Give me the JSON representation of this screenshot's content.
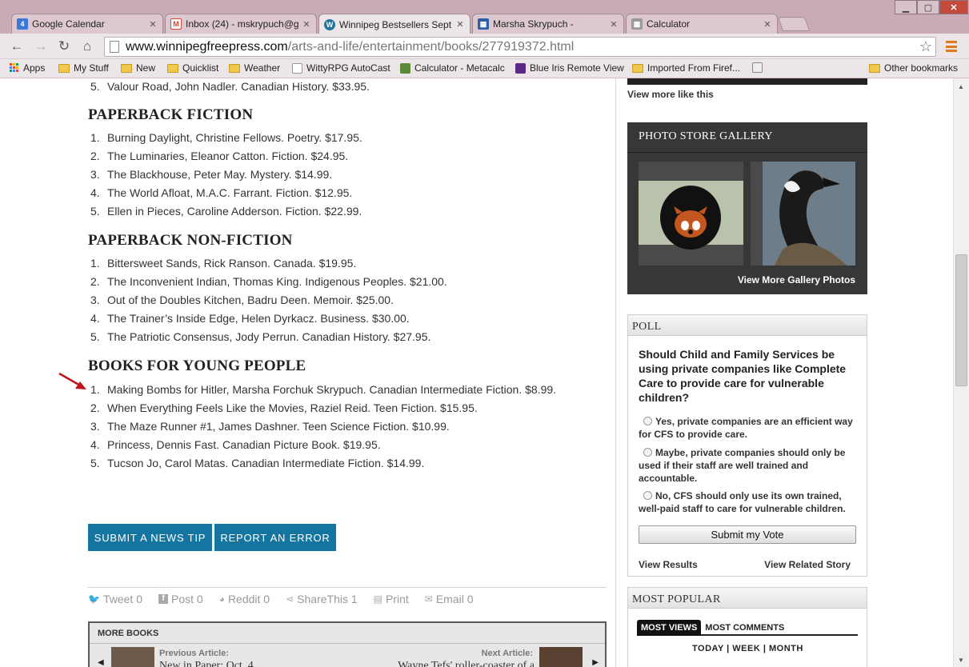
{
  "browser": {
    "tabs": [
      {
        "title": "Google Calendar",
        "icon": "calendar-icon",
        "color": "#3a78d8"
      },
      {
        "title": "Inbox (24) - mskrypuch@g",
        "icon": "gmail-icon",
        "color": "#d44638"
      },
      {
        "title": "Winnipeg Bestsellers Sept",
        "icon": "wordpress-icon",
        "color": "#21759b"
      },
      {
        "title": "Marsha Skrypuch -",
        "icon": "grid-icon",
        "color": "#2d5fa8"
      },
      {
        "title": "Calculator",
        "icon": "calculator-icon",
        "color": "#9a9a9a"
      }
    ],
    "url_host": "www.winnipegfreepress.com",
    "url_path": "/arts-and-life/entertainment/books/277919372.html",
    "bookmarks": [
      "Apps",
      "My Stuff",
      "New",
      "Quicklist",
      "Weather",
      "WittyRPG AutoCast",
      "Calculator - Metacalc",
      "Blue Iris Remote View",
      "Imported From Firef...",
      "Other bookmarks"
    ]
  },
  "article": {
    "top_item": {
      "num": "5.",
      "text": "Valour Road, John Nadler. Canadian History. $33.95."
    },
    "sections": [
      {
        "heading": "PAPERBACK FICTION",
        "items": [
          "Burning Daylight, Christine Fellows. Poetry. $17.95.",
          "The Luminaries, Eleanor Catton. Fiction. $24.95.",
          "The Blackhouse, Peter May. Mystery. $14.99.",
          "The World Afloat, M.A.C. Farrant. Fiction. $12.95.",
          "Ellen in Pieces, Caroline Adderson. Fiction. $22.99."
        ]
      },
      {
        "heading": "PAPERBACK NON-FICTION",
        "items": [
          "Bittersweet Sands, Rick Ranson. Canada. $19.95.",
          "The Inconvenient Indian, Thomas King. Indigenous Peoples. $21.00.",
          "Out of the Doubles Kitchen, Badru Deen. Memoir. $25.00.",
          "The Trainer’s Inside Edge, Helen Dyrkacz. Business. $30.00.",
          "The Patriotic Consensus, Jody Perrun. Canadian History. $27.95."
        ]
      },
      {
        "heading": "BOOKS FOR YOUNG PEOPLE",
        "items": [
          "Making Bombs for Hitler, Marsha Forchuk Skrypuch. Canadian Intermediate Fiction. $8.99.",
          "When Everything Feels Like the Movies, Raziel Reid. Teen Fiction. $15.95.",
          "The Maze Runner #1, James Dashner. Teen Science Fiction. $10.99.",
          "Princess, Dennis Fast. Canadian Picture Book. $19.95.",
          "Tucson Jo, Carol Matas. Canadian Intermediate Fiction. $14.99."
        ]
      }
    ],
    "numbers": [
      "1.",
      "2.",
      "3.",
      "4.",
      "5."
    ],
    "buttons": {
      "news_tip": "SUBMIT A NEWS TIP",
      "report_error": "REPORT AN ERROR"
    },
    "share": {
      "tweet": "Tweet 0",
      "post": "Post 0",
      "reddit": "Reddit 0",
      "sharethis": "ShareThis 1",
      "print": "Print",
      "email": "Email 0"
    },
    "more_books": {
      "title": "MORE BOOKS",
      "prev_label": "Previous Article:",
      "prev_title": "New in Paper: Oct. 4",
      "next_label": "Next Article:",
      "next_title": "Wayne Tefs' roller-coaster of a"
    }
  },
  "sidebar": {
    "view_more": "View more like this",
    "gallery": {
      "title": "PHOTO STORE GALLERY",
      "more": "View More Gallery Photos"
    },
    "poll": {
      "title": "POLL",
      "question": "Should Child and Family Services be using private companies like Complete Care to provide care for vulnerable children?",
      "options": [
        "Yes, private companies are an efficient way for CFS to provide care.",
        "Maybe, private companies should only be used if their staff are well trained and accountable.",
        "No, CFS should only use its own trained, well-paid staff to care for vulnerable children."
      ],
      "submit": "Submit my Vote",
      "view_results": "View Results",
      "view_story": "View Related Story"
    },
    "popular": {
      "title": "MOST POPULAR",
      "tab_views": "MOST VIEWS",
      "tab_comments": "MOST COMMENTS",
      "today": "TODAY",
      "week": "WEEK",
      "month": "MONTH",
      "sep": "|"
    }
  },
  "colors": {
    "accent_blue": "#1476a0",
    "arrow_red": "#c0141c"
  }
}
